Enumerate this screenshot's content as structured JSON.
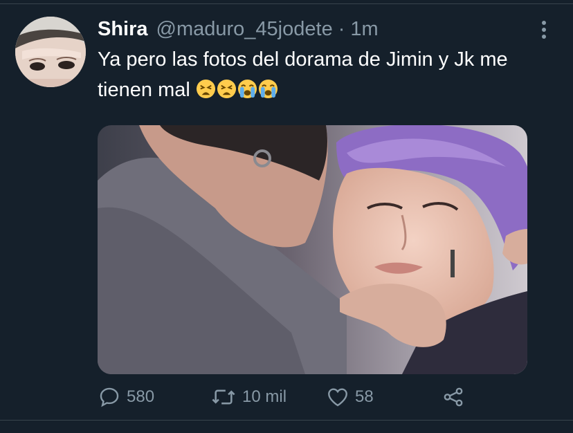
{
  "tweet": {
    "display_name": "Shira",
    "handle": "@maduro_45jodete",
    "separator": "·",
    "time": "1m",
    "text": "Ya pero las fotos del dorama de Jimin y Jk me tienen mal",
    "emojis": [
      "tired-face",
      "tired-face",
      "loudly-crying-face",
      "loudly-crying-face"
    ]
  },
  "actions": {
    "reply_count": "580",
    "retweet_count": "10 mil",
    "like_count": "58"
  },
  "colors": {
    "background": "#15202b",
    "primary_text": "#ffffff",
    "secondary_text": "#8899a6",
    "divider": "#38444d"
  }
}
